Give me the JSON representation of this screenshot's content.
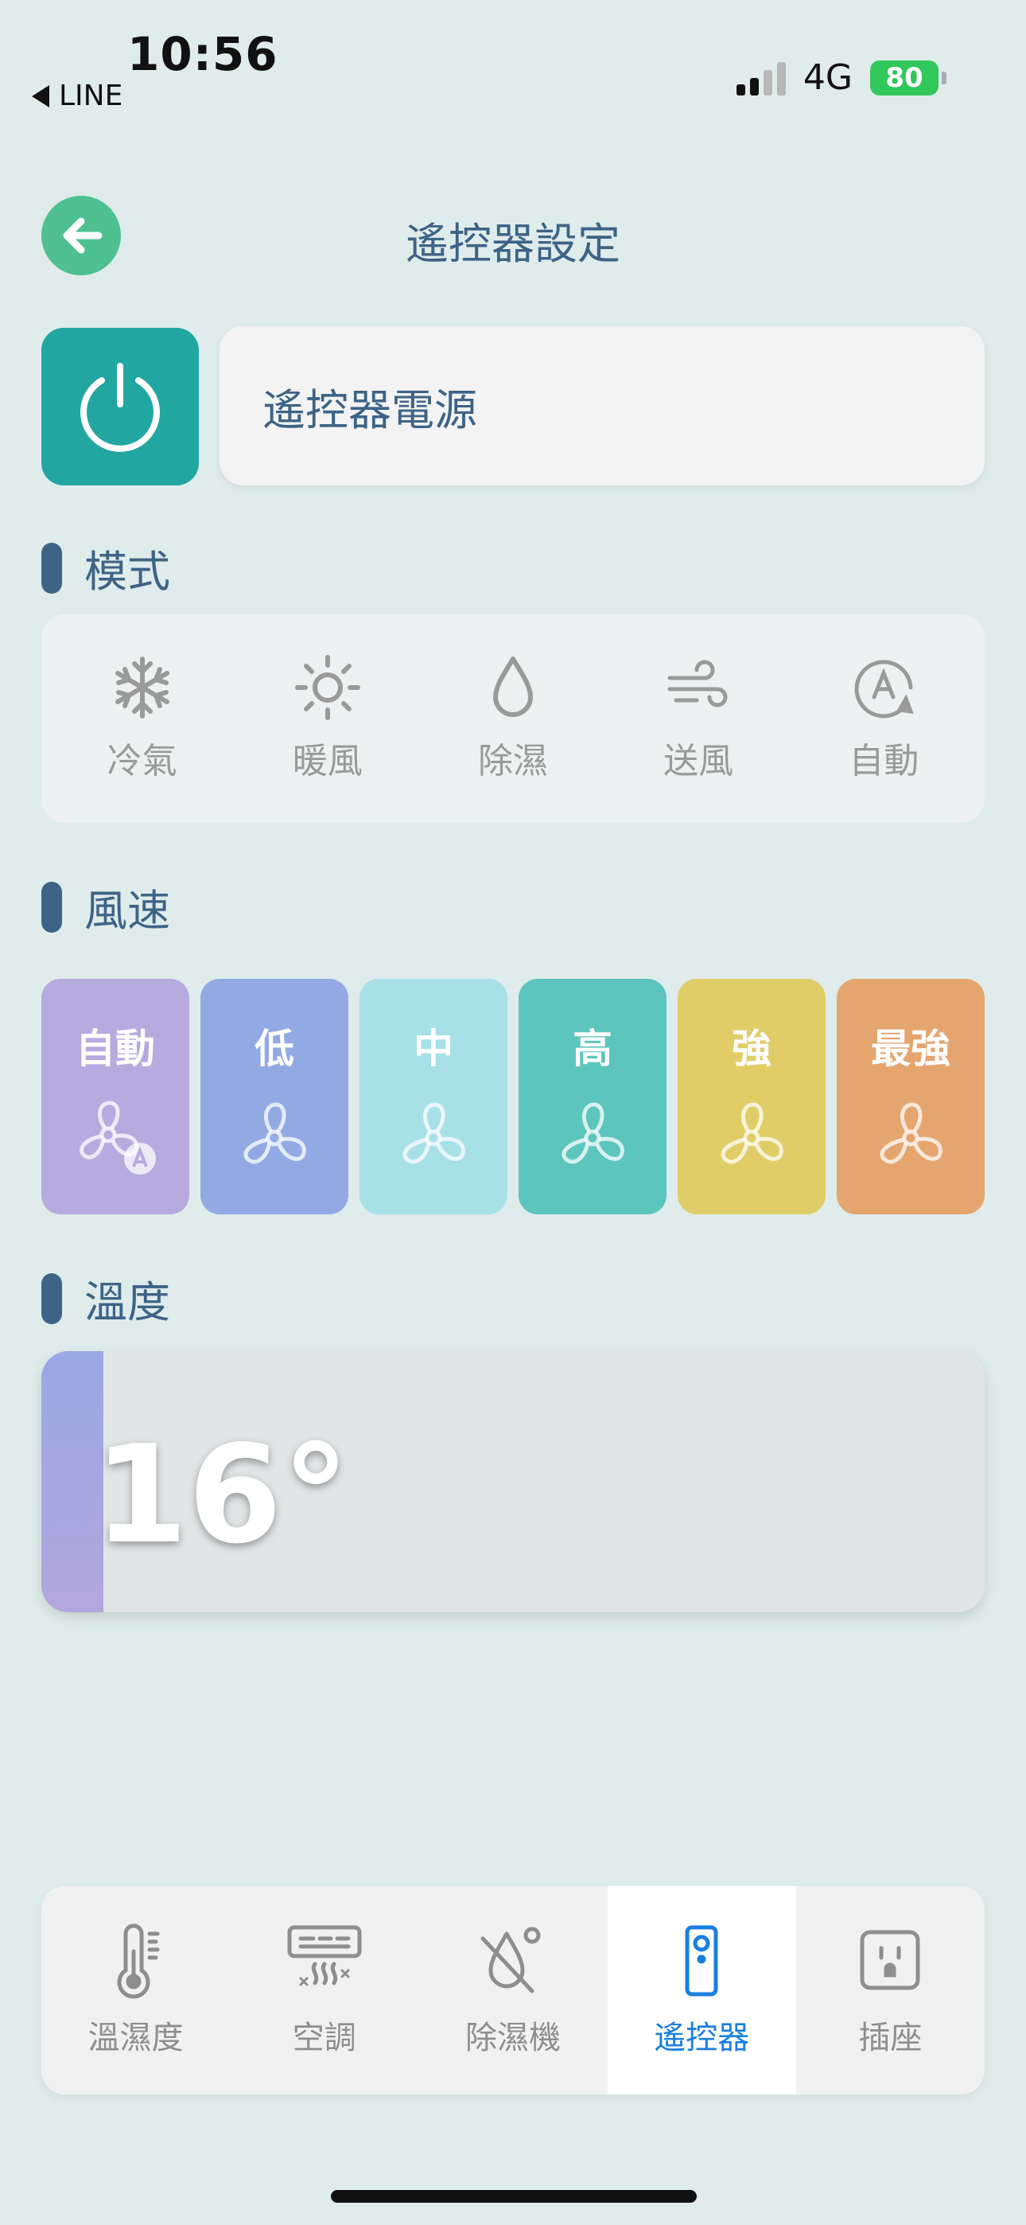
{
  "status": {
    "time": "10:56",
    "back_app": "LINE",
    "network": "4G",
    "battery": "80"
  },
  "header": {
    "title": "遙控器設定"
  },
  "power": {
    "label": "遙控器電源"
  },
  "mode": {
    "heading": "模式",
    "items": [
      {
        "label": "冷氣",
        "icon": "snowflake-icon"
      },
      {
        "label": "暖風",
        "icon": "sun-icon"
      },
      {
        "label": "除濕",
        "icon": "droplet-icon"
      },
      {
        "label": "送風",
        "icon": "wind-icon"
      },
      {
        "label": "自動",
        "icon": "auto-mode-icon"
      }
    ]
  },
  "fan": {
    "heading": "風速",
    "items": [
      {
        "label": "自動",
        "color": "#b7aadf",
        "icon": "fan-auto-icon"
      },
      {
        "label": "低",
        "color": "#92aae4",
        "icon": "fan-icon"
      },
      {
        "label": "中",
        "color": "#a8e0e8",
        "icon": "fan-icon"
      },
      {
        "label": "高",
        "color": "#5cc5bd",
        "icon": "fan-icon"
      },
      {
        "label": "強",
        "color": "#e0cd67",
        "icon": "fan-icon"
      },
      {
        "label": "最強",
        "color": "#e4a56e",
        "icon": "fan-icon"
      }
    ]
  },
  "temperature": {
    "heading": "溫度",
    "value": "16°"
  },
  "tabs": [
    {
      "label": "溫濕度",
      "icon": "thermometer-icon",
      "active": false
    },
    {
      "label": "空調",
      "icon": "air-conditioner-icon",
      "active": false
    },
    {
      "label": "除濕機",
      "icon": "dehumidifier-icon",
      "active": false
    },
    {
      "label": "遙控器",
      "icon": "remote-control-icon",
      "active": true
    },
    {
      "label": "插座",
      "icon": "power-outlet-icon",
      "active": false
    }
  ],
  "colors": {
    "background": "#dfeceb",
    "accent": "#3d6487",
    "power": "#22a6a1",
    "back": "#4fc08f",
    "tab_active": "#1a7fe0"
  }
}
